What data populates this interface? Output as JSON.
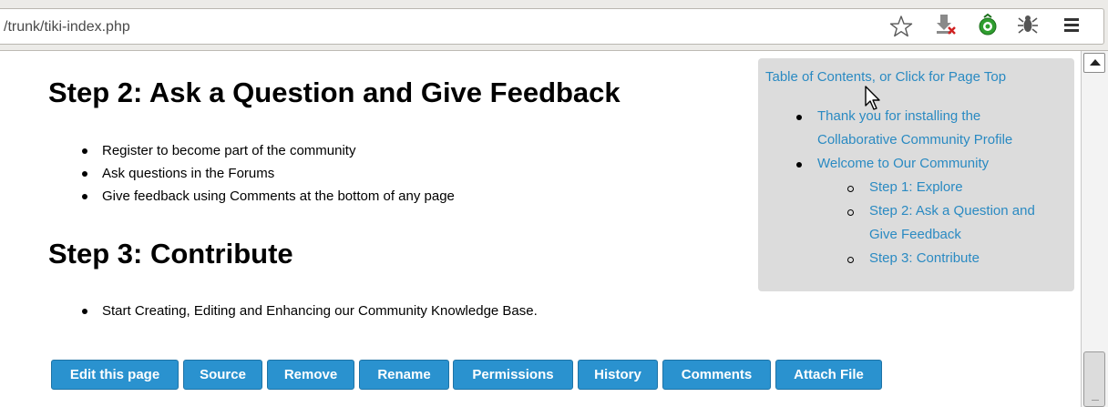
{
  "browser": {
    "url": "/trunk/tiki-index.php"
  },
  "content": {
    "step2_heading": "Step 2: Ask a Question and Give Feedback",
    "step2_items": [
      "Register to become part of the community",
      "Ask questions in the Forums",
      "Give feedback using Comments at the bottom of any page"
    ],
    "step3_heading": "Step 3: Contribute",
    "step3_items": [
      "Start Creating, Editing and Enhancing our Community Knowledge Base."
    ]
  },
  "toc": {
    "title": "Table of Contents, or Click for Page Top",
    "items": [
      {
        "label_line1": "Thank you for installing the",
        "label_line2": "Collaborative Community Profile"
      },
      {
        "label_line1": "Welcome to Our Community"
      }
    ],
    "subitems": [
      {
        "label_line1": "Step 1: Explore"
      },
      {
        "label_line1": "Step 2: Ask a Question and",
        "label_line2": "Give Feedback"
      },
      {
        "label_line1": "Step 3: Contribute"
      }
    ]
  },
  "actions": {
    "edit": "Edit this page",
    "source": "Source",
    "remove": "Remove",
    "rename": "Rename",
    "permissions": "Permissions",
    "history": "History",
    "comments": "Comments",
    "attach": "Attach File"
  },
  "colors": {
    "link": "#2a8ac2",
    "button_bg": "#2a92cf",
    "toc_bg": "#dcdcdc"
  },
  "icons": [
    "bookmark-star-icon",
    "download-blocked-icon",
    "green-addon-icon",
    "bug-icon",
    "menu-icon",
    "mouse-cursor-icon"
  ]
}
